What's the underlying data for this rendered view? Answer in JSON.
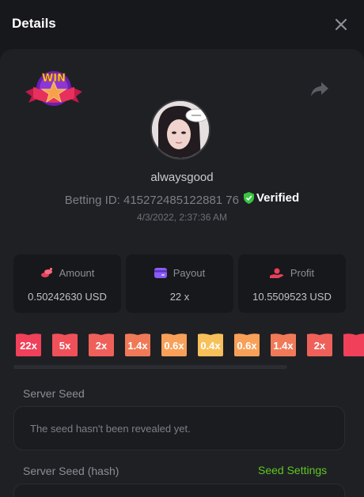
{
  "header": {
    "title": "Details",
    "close_icon": "close-icon"
  },
  "badge": {
    "text": "WIN",
    "icon": "win-star-badge"
  },
  "share_icon": "share-icon",
  "user": {
    "name": "alwaysgood",
    "betting_id_label": "Betting ID: 415272485122881 76",
    "verified": "Verified",
    "date": "4/3/2022, 2:37:36 AM"
  },
  "stats": {
    "amount": {
      "label": "Amount",
      "value": "0.50242630 USD",
      "icon": "coins-icon"
    },
    "payout": {
      "label": "Payout",
      "value": "22 x",
      "icon": "wallet-icon"
    },
    "profit": {
      "label": "Profit",
      "value": "10.5509523 USD",
      "icon": "hand-coin-icon"
    }
  },
  "multipliers": [
    "22x",
    "5x",
    "2x",
    "1.4x",
    "0.6x",
    "0.4x",
    "0.6x",
    "1.4x",
    "2x",
    ""
  ],
  "colors": {
    "accent_green": "#5ec722",
    "mult_colors": [
      "#f0405a",
      "#f0505a",
      "#f0605a",
      "#f07a58",
      "#f8a058",
      "#f8c05a",
      "#f8a058",
      "#f07a58",
      "#f0605a",
      "#f0405a"
    ]
  },
  "server_seed": {
    "label": "Server Seed",
    "value": "The seed hasn't been revealed yet."
  },
  "server_seed_hash": {
    "label": "Server Seed (hash)",
    "settings_link": "Seed Settings"
  }
}
